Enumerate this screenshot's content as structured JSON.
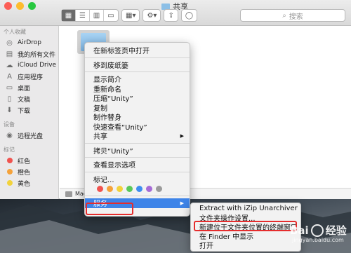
{
  "window": {
    "title": "共享",
    "search_placeholder": "搜索"
  },
  "toolbar": {
    "view_icons": [
      "grid-view-icon",
      "list-view-icon",
      "column-view-icon",
      "gallery-view-icon"
    ],
    "group_icon": "group-icon",
    "action_icon": "gear-icon",
    "share_icon": "share-icon",
    "tag_icon": "tag-icon"
  },
  "sidebar": {
    "favorites_header": "个人收藏",
    "favorites": [
      {
        "label": "AirDrop",
        "icon": "airdrop-icon"
      },
      {
        "label": "我的所有文件",
        "icon": "files-icon"
      },
      {
        "label": "iCloud Drive",
        "icon": "cloud-icon"
      },
      {
        "label": "应用程序",
        "icon": "apps-icon"
      },
      {
        "label": "桌面",
        "icon": "desktop-icon"
      },
      {
        "label": "文稿",
        "icon": "documents-icon"
      },
      {
        "label": "下载",
        "icon": "download-icon"
      }
    ],
    "devices_header": "设备",
    "devices": [
      {
        "label": "远程光盘",
        "icon": "disc-icon"
      }
    ],
    "tags_header": "标记",
    "tags": [
      {
        "label": "红色",
        "color": "#f0534f"
      },
      {
        "label": "橙色",
        "color": "#f5a23a"
      },
      {
        "label": "黄色",
        "color": "#f2d23b"
      }
    ]
  },
  "pathbar": {
    "label": "Mac"
  },
  "context_menu": {
    "items": [
      {
        "label": "在新标签页中打开"
      },
      {
        "sep": true
      },
      {
        "label": "移到废纸篓"
      },
      {
        "sep": true
      },
      {
        "label": "显示简介"
      },
      {
        "label": "重新命名"
      },
      {
        "label": "压缩“Unity”"
      },
      {
        "label": "复制"
      },
      {
        "label": "制作替身"
      },
      {
        "label": "快速查看“Unity”"
      },
      {
        "label": "共享",
        "submenu": true
      },
      {
        "sep": true
      },
      {
        "label": "拷贝“Unity”"
      },
      {
        "sep": true
      },
      {
        "label": "查看显示选项"
      },
      {
        "sep": true
      },
      {
        "label": "标记..."
      }
    ],
    "tag_colors": [
      "#f0534f",
      "#f5a23a",
      "#f2d23b",
      "#5ac85a",
      "#3e8df0",
      "#a66bd6",
      "#9b9b9b"
    ],
    "services_label": "服务"
  },
  "submenu": {
    "items": [
      "Extract with iZip Unarchiver",
      "文件夹操作设置...",
      "新建位于文件夹位置的终端窗口",
      "在 Finder 中显示",
      "打开"
    ]
  },
  "watermark": {
    "brand": "Bai",
    "text": "经验",
    "url": "jingyan.baidu.com"
  }
}
